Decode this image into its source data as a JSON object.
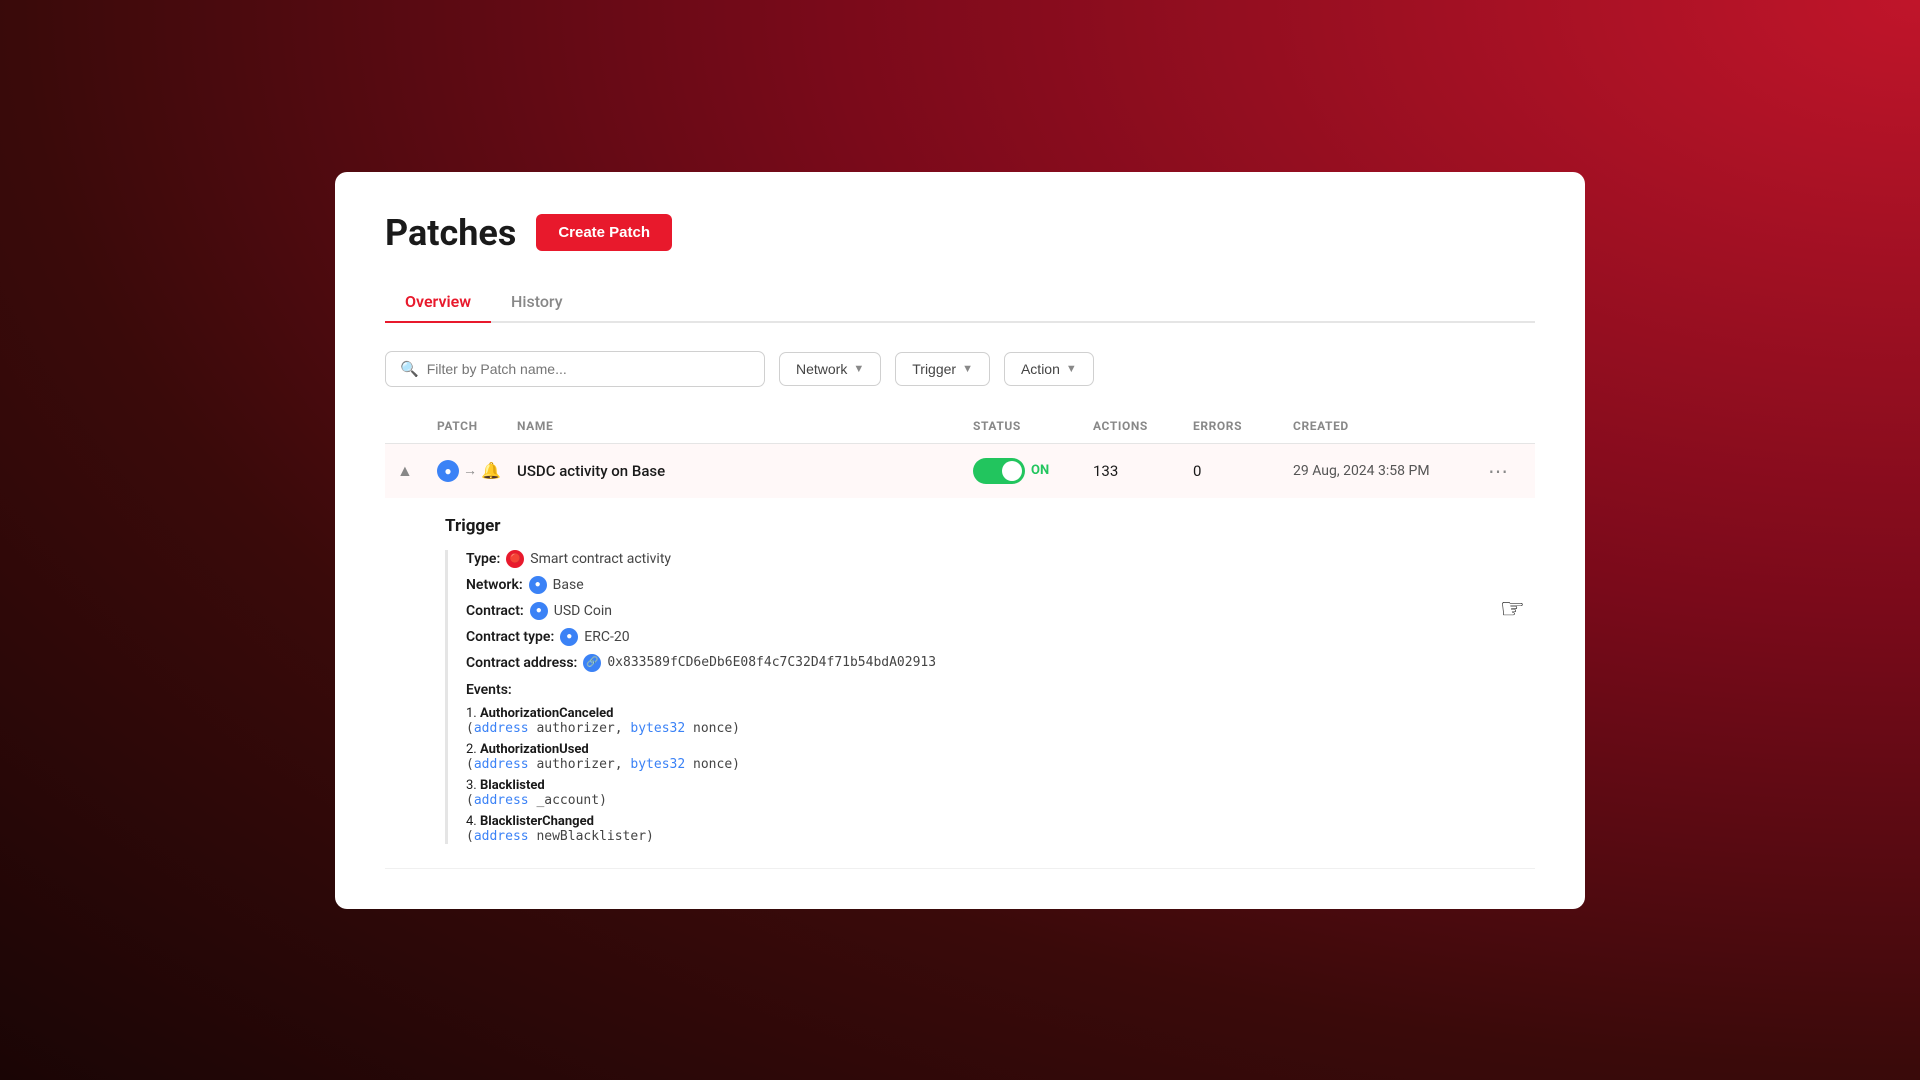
{
  "page": {
    "title": "Patches",
    "create_btn": "Create Patch"
  },
  "tabs": [
    {
      "id": "overview",
      "label": "Overview",
      "active": true
    },
    {
      "id": "history",
      "label": "History",
      "active": false
    }
  ],
  "filters": {
    "search_placeholder": "Filter by Patch name...",
    "network_label": "Network",
    "trigger_label": "Trigger",
    "action_label": "Action"
  },
  "table": {
    "columns": [
      "",
      "PATCH",
      "NAME",
      "STATUS",
      "ACTIONS",
      "ERRORS",
      "CREATED",
      ""
    ],
    "rows": [
      {
        "id": 1,
        "name": "USDC activity on Base",
        "status": "ON",
        "actions": "133",
        "errors": "0",
        "created": "29 Aug, 2024 3:58 PM",
        "expanded": true
      }
    ]
  },
  "detail": {
    "trigger_label": "Trigger",
    "type_label": "Type:",
    "type_value": "Smart contract activity",
    "network_label": "Network:",
    "network_value": "Base",
    "contract_label": "Contract:",
    "contract_value": "USD Coin",
    "contract_type_label": "Contract type:",
    "contract_type_value": "ERC-20",
    "contract_address_label": "Contract address:",
    "contract_address_value": "0x833589fCD6eDb6E08f4c7C32D4f71b54bdA02913",
    "events_label": "Events:",
    "events": [
      {
        "number": "1.",
        "name": "AuthorizationCanceled",
        "params": "(address authorizer, bytes32 nonce)"
      },
      {
        "number": "2.",
        "name": "AuthorizationUsed",
        "params": "(address authorizer, bytes32 nonce)"
      },
      {
        "number": "3.",
        "name": "Blacklisted",
        "params": "(address _account)"
      },
      {
        "number": "4.",
        "name": "BlacklisterChanged",
        "params": "(address newBlacklister)"
      }
    ]
  }
}
